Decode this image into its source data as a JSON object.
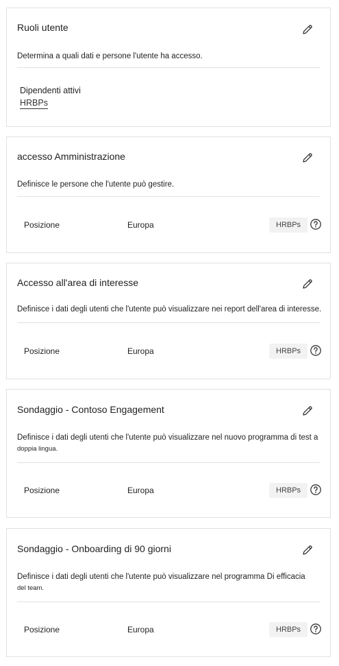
{
  "roles_card": {
    "title": "Ruoli utente",
    "description": "Determina a quali dati e persone l'utente ha accesso.",
    "dependents_label": "Dipendenti attivi",
    "dependents_link": "HRBPs"
  },
  "cards": [
    {
      "title": "accesso Amministrazione",
      "description": "Definisce le persone che l'utente può gestire.",
      "description_cont": "",
      "row": {
        "field": "Posizione",
        "value": "Europa",
        "tag": "HRBPs"
      }
    },
    {
      "title": "Accesso all'area di interesse",
      "description": "Definisce i dati degli utenti che l'utente può visualizzare nei report dell'area di interesse.",
      "description_cont": "",
      "row": {
        "field": "Posizione",
        "value": "Europa",
        "tag": "HRBPs"
      }
    },
    {
      "title": "Sondaggio - Contoso Engagement",
      "description": "Definisce i dati degli utenti che l'utente può visualizzare nel nuovo programma di test a",
      "description_cont": "doppia lingua.",
      "row": {
        "field": "Posizione",
        "value": "Europa",
        "tag": "HRBPs"
      }
    },
    {
      "title": "Sondaggio - Onboarding di 90 giorni",
      "description": "Definisce i dati degli utenti che l'utente può visualizzare nel programma Di efficacia",
      "description_cont": "del team.",
      "row": {
        "field": "Posizione",
        "value": "Europa",
        "tag": "HRBPs"
      }
    }
  ],
  "icons": {
    "edit": "pencil-icon",
    "help": "question-circle-icon"
  }
}
